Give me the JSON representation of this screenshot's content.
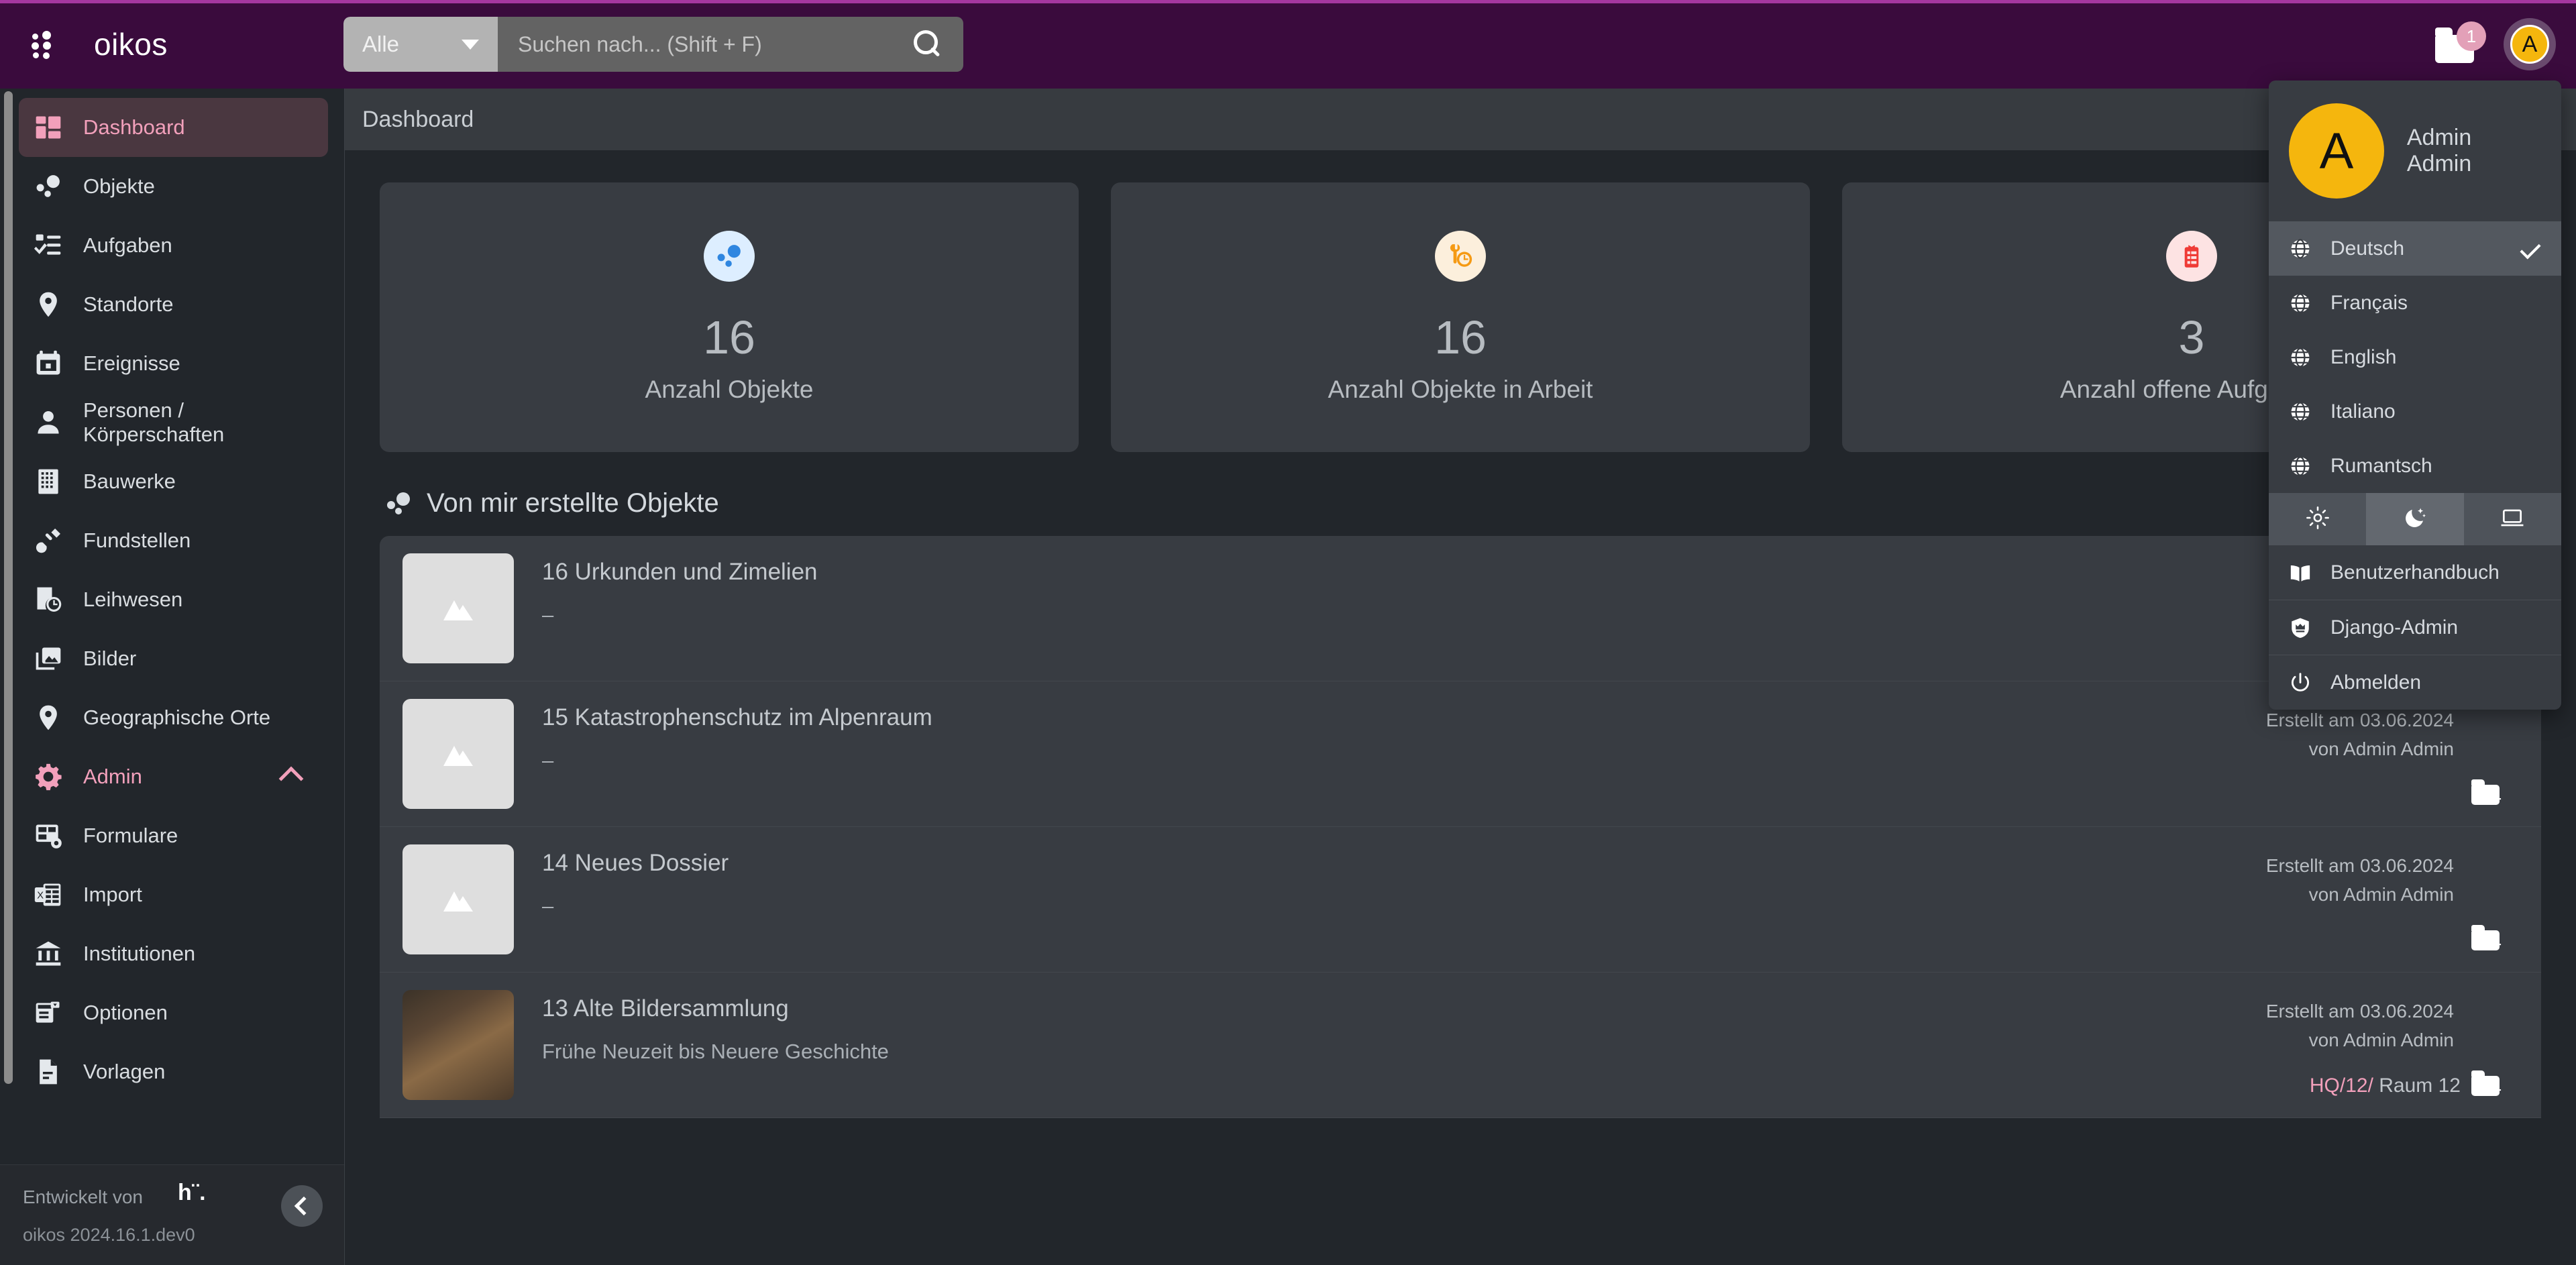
{
  "topbar": {
    "app_icon": "grid-dots-icon",
    "brand": "oikos",
    "search": {
      "scope_value": "Alle",
      "placeholder": "Suchen nach... (Shift + F)",
      "icon": "search-icon"
    },
    "notifications": {
      "icon": "folder-icon",
      "count": "1"
    },
    "avatar_initial": "A"
  },
  "breadcrumb": {
    "label": "Dashboard"
  },
  "sidebar": {
    "items": [
      {
        "label": "Dashboard",
        "icon": "dashboard-icon",
        "state": "active"
      },
      {
        "label": "Objekte",
        "icon": "objects-bubbles-icon",
        "state": "normal"
      },
      {
        "label": "Aufgaben",
        "icon": "tasks-checklist-icon",
        "state": "normal"
      },
      {
        "label": "Standorte",
        "icon": "map-pin-icon",
        "state": "normal"
      },
      {
        "label": "Ereignisse",
        "icon": "calendar-icon",
        "state": "normal"
      },
      {
        "label": "Personen / Körperschaften",
        "icon": "person-icon",
        "state": "normal"
      },
      {
        "label": "Bauwerke",
        "icon": "building-grid-icon",
        "state": "normal"
      },
      {
        "label": "Fundstellen",
        "icon": "shovel-icon",
        "state": "normal"
      },
      {
        "label": "Leihwesen",
        "icon": "receipt-clock-icon",
        "state": "normal"
      },
      {
        "label": "Bilder",
        "icon": "images-icon",
        "state": "normal"
      },
      {
        "label": "Geographische Orte",
        "icon": "map-pin-icon",
        "state": "normal"
      },
      {
        "label": "Admin",
        "icon": "admin-gear-icon",
        "state": "accent",
        "expanded": true
      },
      {
        "label": "Formulare",
        "icon": "form-layout-icon",
        "state": "normal"
      },
      {
        "label": "Import",
        "icon": "excel-import-icon",
        "state": "normal"
      },
      {
        "label": "Institutionen",
        "icon": "bank-icon",
        "state": "normal"
      },
      {
        "label": "Optionen",
        "icon": "options-panel-icon",
        "state": "normal"
      },
      {
        "label": "Vorlagen",
        "icon": "document-icon",
        "state": "normal"
      }
    ],
    "footer": {
      "developed_by": "Entwickelt von",
      "developer_logo": "h¨.",
      "version": "oikos 2024.16.1.dev0",
      "collapse_icon": "chevron-left-icon"
    }
  },
  "main": {
    "cards": [
      {
        "icon": "objects-bubbles-icon",
        "icon_bg": "#ddeeff",
        "icon_color": "#2f86e0",
        "value": "16",
        "label": "Anzahl Objekte"
      },
      {
        "icon": "wrench-clock-icon",
        "icon_bg": "#fcefdc",
        "icon_color": "#f59a14",
        "value": "16",
        "label": "Anzahl Objekte in Arbeit"
      },
      {
        "icon": "task-list-icon",
        "icon_bg": "#fde3e3",
        "icon_color": "#ef3b36",
        "value": "3",
        "label": "Anzahl offene Aufgaben"
      }
    ],
    "section": {
      "icon": "objects-bubbles-icon",
      "title": "Von mir erstellte Objekte"
    },
    "rows": [
      {
        "title": "16 Urkunden und Zimelien",
        "subtitle": "–",
        "thumb": "placeholder",
        "created": "",
        "author": "",
        "folder_icon": "folder-add-icon",
        "location": ""
      },
      {
        "title": "15 Katastrophenschutz im Alpenraum",
        "subtitle": "–",
        "thumb": "placeholder",
        "created": "Erstellt am 03.06.2024",
        "author": "von Admin Admin",
        "folder_icon": "folder-add-icon",
        "location": ""
      },
      {
        "title": "14 Neues Dossier",
        "subtitle": "–",
        "thumb": "placeholder",
        "created": "Erstellt am 03.06.2024",
        "author": "von Admin Admin",
        "folder_icon": "folder-add-icon",
        "location": ""
      },
      {
        "title": "13 Alte Bildersammlung",
        "subtitle": "Frühe Neuzeit bis Neuere Geschichte",
        "thumb": "photo",
        "created": "Erstellt am 03.06.2024",
        "author": "von Admin Admin",
        "folder_icon": "folder-add-icon",
        "location_code": "HQ/12/",
        "location_name": " Raum 12"
      }
    ]
  },
  "user_menu": {
    "avatar_initial": "A",
    "name": "Admin Admin",
    "languages": [
      {
        "label": "Deutsch",
        "icon": "globe-icon",
        "selected": true
      },
      {
        "label": "Français",
        "icon": "globe-icon",
        "selected": false
      },
      {
        "label": "English",
        "icon": "globe-icon",
        "selected": false
      },
      {
        "label": "Italiano",
        "icon": "globe-icon",
        "selected": false
      },
      {
        "label": "Rumantsch",
        "icon": "globe-icon",
        "selected": false
      }
    ],
    "themes": [
      {
        "icon": "sun-icon",
        "active": false
      },
      {
        "icon": "moon-icon",
        "active": true
      },
      {
        "icon": "laptop-icon",
        "active": false
      }
    ],
    "actions": [
      {
        "label": "Benutzerhandbuch",
        "icon": "book-icon"
      },
      {
        "label": "Django-Admin",
        "icon": "shield-crown-icon"
      },
      {
        "label": "Abmelden",
        "icon": "power-icon"
      }
    ]
  },
  "colors": {
    "brand_purple": "#3a0b3d",
    "accent_pink": "#f2a0bb",
    "panel": "#383c42",
    "bg": "#22262b"
  }
}
